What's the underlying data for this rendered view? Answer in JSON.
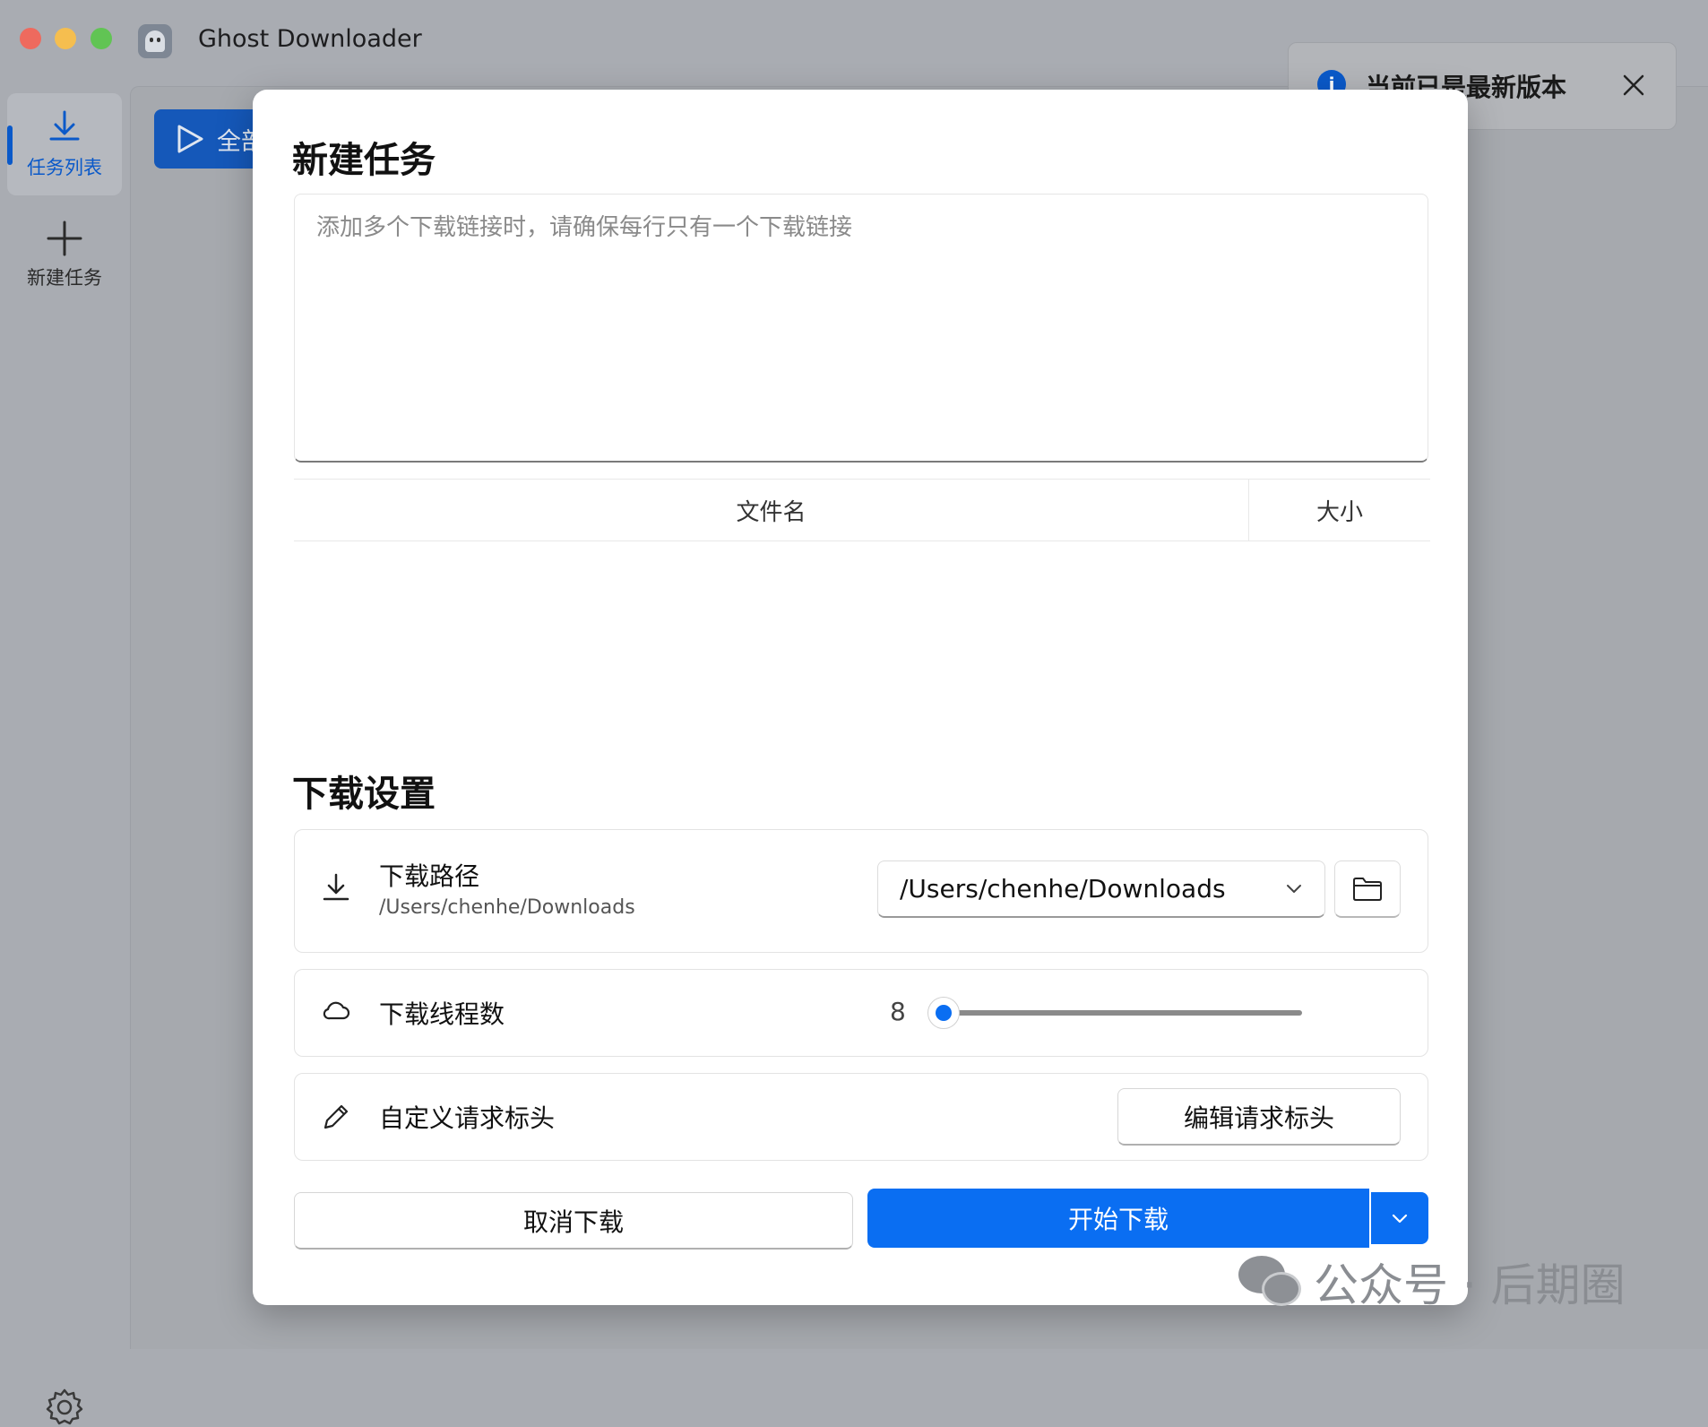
{
  "window": {
    "title": "Ghost Downloader"
  },
  "sidebar": {
    "items": [
      {
        "label": "任务列表",
        "icon": "download-icon",
        "active": true
      },
      {
        "label": "新建任务",
        "icon": "plus-icon",
        "active": false
      }
    ],
    "settings_icon": "gear-icon"
  },
  "background": {
    "start_all_label": "全部"
  },
  "toast": {
    "message": "当前已是最新版本",
    "icon": "info-icon"
  },
  "dialog": {
    "title": "新建任务",
    "url_input": {
      "value": "",
      "placeholder": "添加多个下载链接时，请确保每行只有一个下载链接"
    },
    "table": {
      "columns": [
        "文件名",
        "大小"
      ],
      "rows": []
    },
    "settings_title": "下载设置",
    "download_path": {
      "label": "下载路径",
      "current": "/Users/chenhe/Downloads",
      "selected": "/Users/chenhe/Downloads",
      "icon": "download-icon",
      "browse_icon": "folder-icon"
    },
    "threads": {
      "label": "下载线程数",
      "value": "8",
      "icon": "cloud-icon",
      "slider_fraction": 0.0
    },
    "headers": {
      "label": "自定义请求标头",
      "button": "编辑请求标头",
      "icon": "pencil-icon"
    },
    "buttons": {
      "cancel": "取消下载",
      "start": "开始下载"
    }
  },
  "watermark": {
    "text": "公众号 · 后期圈"
  },
  "colors": {
    "accent": "#0a6ef2",
    "sidebar_active": "#0a59c9"
  }
}
